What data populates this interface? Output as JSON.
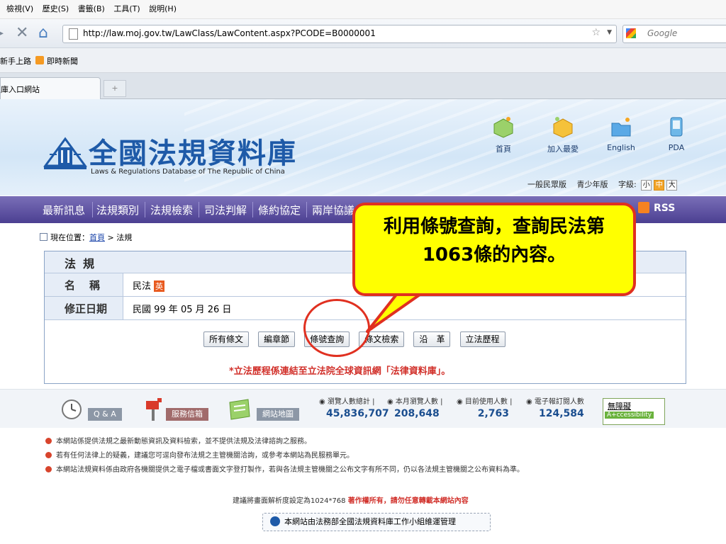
{
  "browser": {
    "menu": [
      "檢視(V)",
      "歷史(S)",
      "書籤(B)",
      "工具(T)",
      "說明(H)"
    ],
    "url": "http://law.moj.gov.tw/LawClass/LawContent.aspx?PCODE=B0000001",
    "search_placeholder": "Google",
    "bookmarks": [
      "新手上路",
      "即時新聞"
    ],
    "tab_title": "庫入口網站"
  },
  "site": {
    "logo_title": "全國法規資料庫",
    "logo_sub": "Laws & Regulations Database of The Republic of China",
    "top_icons": [
      "首頁",
      "加入最愛",
      "English",
      "PDA"
    ],
    "versions": [
      "一般民眾版",
      "青少年版"
    ],
    "font_size_label": "字級:",
    "font_sizes": [
      "小",
      "中",
      "大"
    ],
    "nav": [
      "最新訊息",
      "法規類別",
      "法規檢索",
      "司法判解",
      "條約協定",
      "兩岸協議"
    ],
    "rss": "RSS"
  },
  "breadcrumb": {
    "prefix": "現在位置：",
    "home": "首頁",
    "sep": " > ",
    "current": "法規"
  },
  "law": {
    "header": "法規",
    "name_label": "名稱",
    "name_value": "民法",
    "en_badge": "英",
    "date_label": "修正日期",
    "date_value": "民國 99 年 05 月 26 日",
    "buttons": [
      "所有條文",
      "編章節",
      "條號查詢",
      "條文檢索",
      "沿　革",
      "立法歷程"
    ],
    "note": "*立法歷程係連結至立法院全球資訊網「法律資料庫」。"
  },
  "callout": {
    "text": "利用條號查詢，查詢民法第1063條的內容。"
  },
  "footer": {
    "qa": "Q & A",
    "service": "服務信箱",
    "sitemap": "網站地圖",
    "stats": [
      {
        "label": "瀏覽人數總計",
        "value": "45,836,707"
      },
      {
        "label": "本月瀏覽人數",
        "value": "208,648"
      },
      {
        "label": "目前使用人數",
        "value": "2,763"
      },
      {
        "label": "電子報訂閱人數",
        "value": "124,584"
      }
    ],
    "accessibility_title": "無障礙",
    "accessibility_badge": "A+ccessibility",
    "disclaimers": [
      "本網站係提供法規之最新動態資訊及資料檢索，並不提供法規及法律諮詢之服務。",
      "若有任何法律上的疑義，建議您可逕向發布法規之主管機關洽詢，或參考本網站為民服務單元。",
      "本網站法規資料係由政府各機關提供之電子檔或書面文字登打製作，若與各法規主管機關之公布文字有所不同，仍以各法規主管機關之公布資料為準。"
    ],
    "resolution": "建議將畫面解析度設定為1024*768",
    "copyright": "著作權所有，請勿任意轉載本網站內容",
    "maintained": "本網站由法務部全國法規資料庫工作小組維運管理"
  }
}
